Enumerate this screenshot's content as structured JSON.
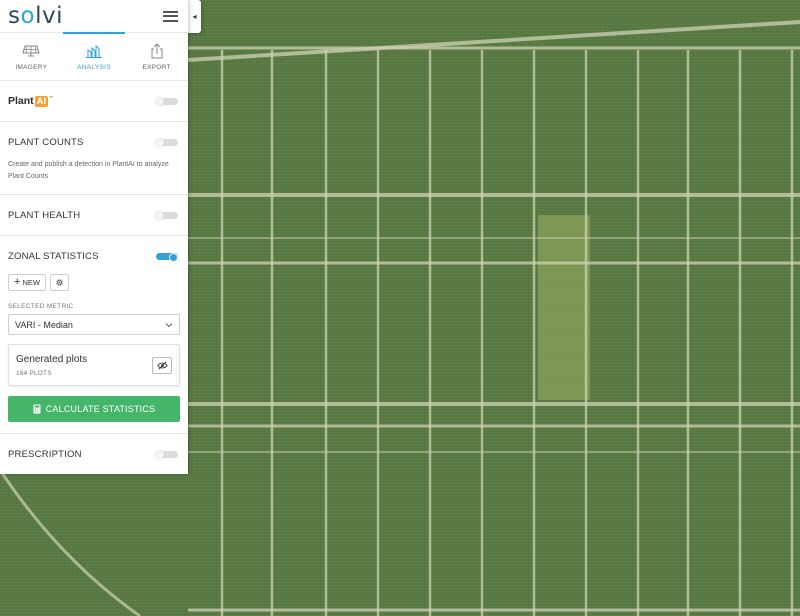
{
  "app": {
    "logo": "solvi"
  },
  "tabs": [
    {
      "label": "IMAGERY",
      "icon": "solar-panel-icon",
      "active": false
    },
    {
      "label": "ANALYSIS",
      "icon": "analysis-chart-icon",
      "active": true
    },
    {
      "label": "EXPORT",
      "icon": "export-share-icon",
      "active": false
    }
  ],
  "plantai": {
    "name": "Plant",
    "badge": "AI",
    "mark": "™",
    "enabled": false
  },
  "plant_counts": {
    "title": "PLANT COUNTS",
    "enabled": false,
    "description": "Create and publish a detection in PlantAI to analyze Plant Counts"
  },
  "plant_health": {
    "title": "PLANT HEALTH",
    "enabled": false
  },
  "zonal_statistics": {
    "title": "ZONAL STATISTICS",
    "enabled": true,
    "new_label": "NEW",
    "selected_metric_label": "SELECTED METRIC",
    "selected_metric": "VARI - Median",
    "card_title": "Generated plots",
    "card_subtitle": "164 PLOTS",
    "calculate_label": "CALCULATE STATISTICS"
  },
  "prescription": {
    "title": "PRESCRIPTION",
    "enabled": false
  },
  "colors": {
    "accent": "#2fa3d6",
    "primary_button": "#45b569",
    "field": "#587a42",
    "path": "#cfd3b4",
    "highlight": "#9cae63"
  }
}
